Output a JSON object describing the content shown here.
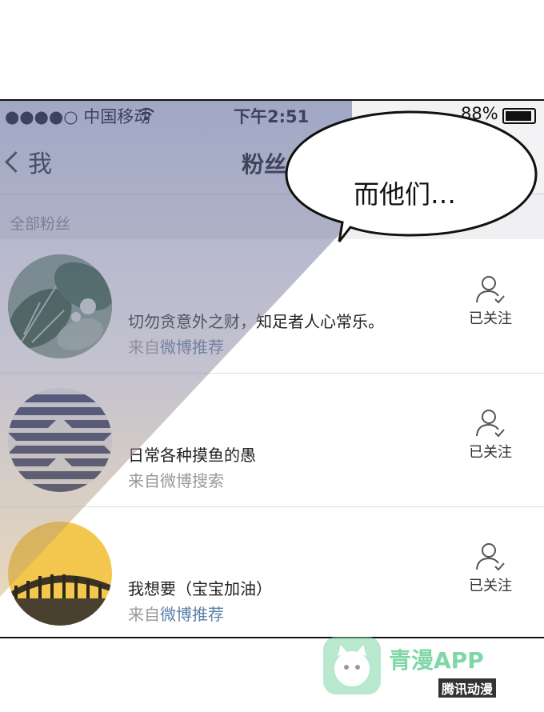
{
  "status_bar": {
    "carrier": "●●●●○ 中国移动",
    "time": "下午2:51",
    "battery": "88%"
  },
  "nav": {
    "back_label": "我",
    "title": "粉丝"
  },
  "section_header": "全部粉丝",
  "followers": [
    {
      "name": "切勿贪意外之财，知足者人心常乐。",
      "source_prefix": "来自",
      "source_link": "微博推荐",
      "source_link_highlight": true,
      "follow_label": "已关注"
    },
    {
      "name": "日常各种摸鱼的愚",
      "source_prefix": "来自",
      "source_link": "微博搜索",
      "source_link_highlight": false,
      "follow_label": "已关注"
    },
    {
      "name": "我想要（宝宝加油）",
      "source_prefix": "来自",
      "source_link": "微博推荐",
      "source_link_highlight": true,
      "follow_label": "已关注"
    }
  ],
  "speech_bubble": "而他们…",
  "watermark": {
    "brand": "青漫APP",
    "sub": "腾讯动漫"
  },
  "colors": {
    "overlay_tint": "#6f7aa8",
    "bubble": "#ffffff",
    "link": "#5b7fa8"
  }
}
